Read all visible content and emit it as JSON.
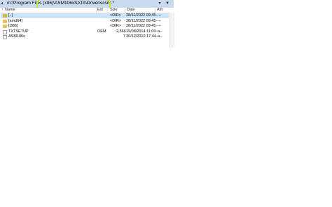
{
  "path_bar": {
    "prefix": "m:\\Program Files",
    "highlighted": "(x86)\\ASM106xSATA\\Driver\\scsi\\*.*",
    "dropdown_glyph": "▾",
    "history_glyph": "▼"
  },
  "columns": {
    "name": "Name",
    "ext": "Ext",
    "size": "Size",
    "date": "Date",
    "attr": "Attr"
  },
  "rows": [
    {
      "name": "[..]",
      "ext": "",
      "size": "<DIR>",
      "date": "28/11/2022 09:45",
      "attr": "----",
      "icon": "up-folder-icon"
    },
    {
      "name": "[amd64]",
      "ext": "",
      "size": "<DIR>",
      "date": "28/11/2022 09:45",
      "attr": "----",
      "icon": "folder-icon"
    },
    {
      "name": "[i386]",
      "ext": "",
      "size": "<DIR>",
      "date": "28/11/2022 09:45",
      "attr": "----",
      "icon": "folder-icon"
    },
    {
      "name": "TXTSETUP",
      "ext": "OEM",
      "size": "2,566",
      "date": "19/08/2014 11:09",
      "attr": "-a--",
      "icon": "file-icon"
    },
    {
      "name": "ASM106x",
      "ext": "",
      "size": "7",
      "date": "30/12/2010 17:44",
      "attr": "-a--",
      "icon": "file-icon"
    }
  ],
  "colors": {
    "path_bar_bg": "#c9d9ee",
    "highlight_outline": "#c8e23a",
    "selected_row": "#cce4f7"
  }
}
